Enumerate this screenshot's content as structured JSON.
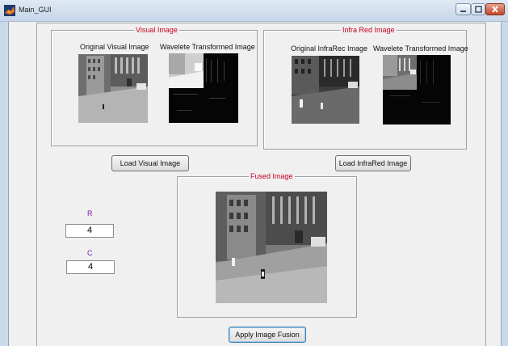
{
  "window": {
    "title": "Main_GUI",
    "accent_color": "#c8001e",
    "app_icon": "matlab-logo-icon"
  },
  "visual_panel": {
    "title": "Visual Image",
    "original_caption": "Original Visual Image",
    "wavelet_caption": "Wavelete Transformed Image"
  },
  "ir_panel": {
    "title": "Infra Red  Image",
    "original_caption": "Original InfraRec Image",
    "wavelet_caption": "Wavelete Transformed Image"
  },
  "fused_panel": {
    "title": "Fused Image"
  },
  "buttons": {
    "load_visual": "Load Visual Image",
    "load_ir": "Load InfraRed Image",
    "apply_fusion": "Apply Image Fusion"
  },
  "inputs": {
    "r_label": "R",
    "r_value": "4",
    "c_label": "C",
    "c_value": "4"
  }
}
